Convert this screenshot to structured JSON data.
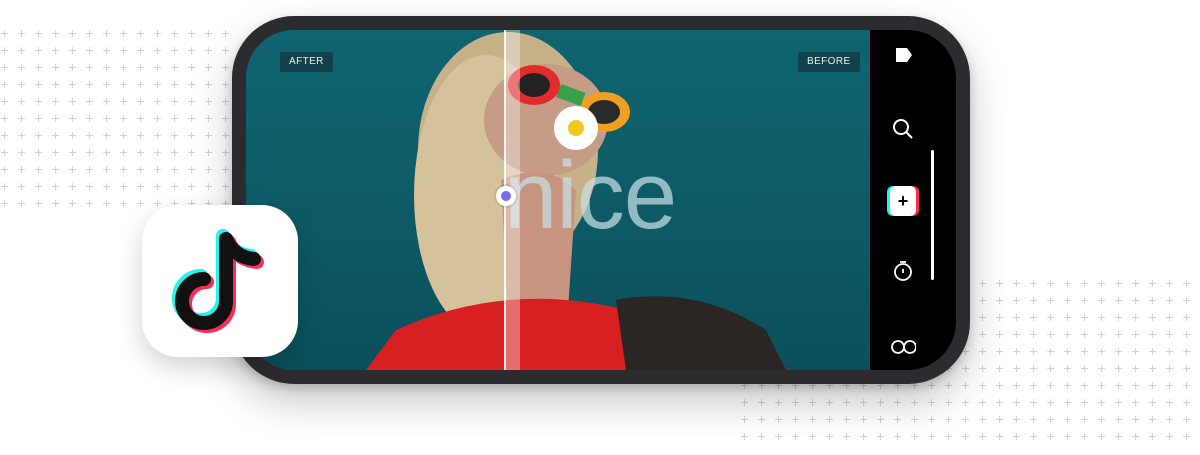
{
  "app": {
    "name": "TikTok"
  },
  "editor": {
    "after_label": "AFTER",
    "before_label": "BEFORE",
    "overlay_text": "nice"
  },
  "rail": {
    "icons": [
      "tag-icon",
      "search-icon",
      "add-icon",
      "timer-icon",
      "infinity-icon"
    ],
    "add_label": "+"
  },
  "colors": {
    "phone_frame": "#2c2c30",
    "photo_background": "#0f6470",
    "handle_accent": "#7a6cf0",
    "tiktok_cyan": "#25f4ee",
    "tiktok_red": "#fe2c55"
  }
}
